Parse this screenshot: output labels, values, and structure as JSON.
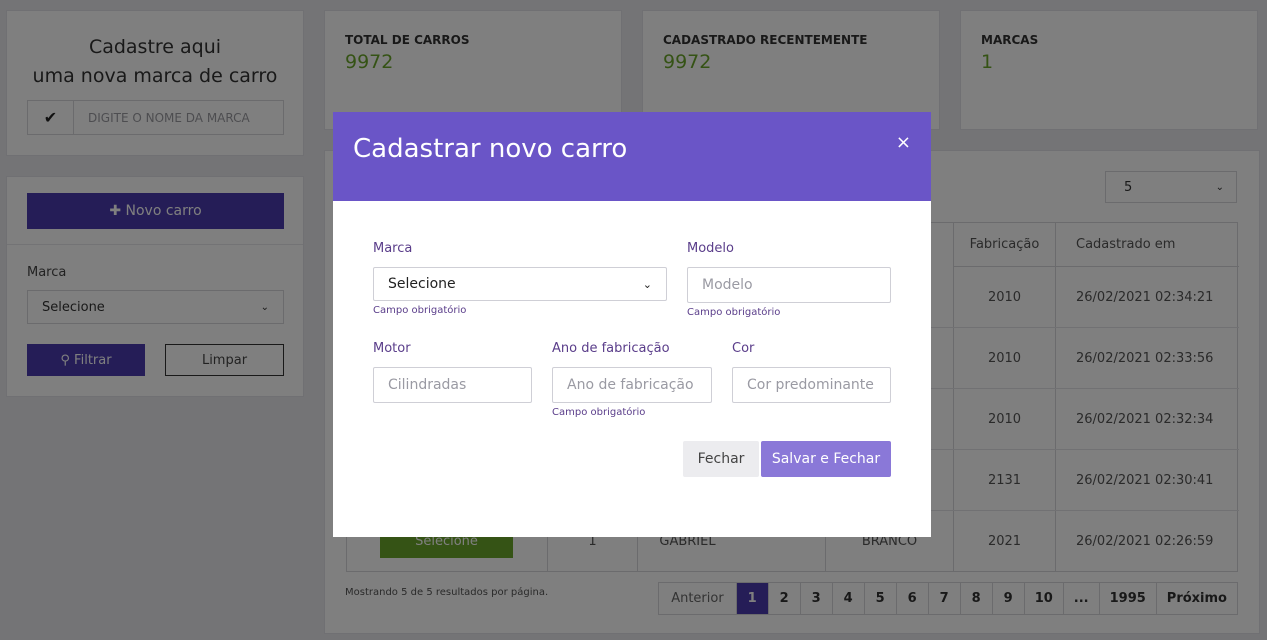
{
  "brand_card": {
    "title_line1": "Cadastre aqui",
    "title_line2": "uma nova marca de carro",
    "input_placeholder": "DIGITE O NOME DA MARCA"
  },
  "filter_card": {
    "new_car_label": "✚ Novo carro",
    "brand_label": "Marca",
    "brand_selected": "Selecione",
    "filter_label": "⚲ Filtrar",
    "clear_label": "Limpar"
  },
  "stats": [
    {
      "label": "TOTAL DE CARROS",
      "value": "9972"
    },
    {
      "label": "CADASTRADO RECENTEMENTE",
      "value": "9972"
    },
    {
      "label": "MARCAS",
      "value": "1"
    }
  ],
  "list": {
    "per_page": "5",
    "headers": {
      "fabricacao": "Fabricação",
      "cadastrado": "Cadastrado em"
    },
    "rows": [
      {
        "year": "2010",
        "date": "26/02/2021 02:34:21"
      },
      {
        "year": "2010",
        "date": "26/02/2021 02:33:56"
      },
      {
        "year": "2010",
        "date": "26/02/2021 02:32:34"
      },
      {
        "year": "2131",
        "date": "26/02/2021 02:30:41"
      },
      {
        "year": "2021",
        "date": "26/02/2021 02:26:59",
        "id": "1",
        "owner": "GABRIEL",
        "color": "BRANCO",
        "select_label": "Selecione"
      }
    ],
    "showing": "Mostrando 5 de 5 resultados por página.",
    "pager": [
      "Anterior",
      "1",
      "2",
      "3",
      "4",
      "5",
      "6",
      "7",
      "8",
      "9",
      "10",
      "...",
      "1995",
      "Próximo"
    ]
  },
  "modal": {
    "title": "Cadastrar novo carro",
    "close": "×",
    "marca_label": "Marca",
    "marca_selected": "Selecione",
    "modelo_label": "Modelo",
    "modelo_placeholder": "Modelo",
    "motor_label": "Motor",
    "motor_placeholder": "Cilindradas",
    "ano_label": "Ano de fabricação",
    "ano_placeholder": "Ano de fabricação",
    "cor_label": "Cor",
    "cor_placeholder": "Cor predominante",
    "required_hint": "Campo obrigatório",
    "btn_close": "Fechar",
    "btn_save": "Salvar e Fechar"
  }
}
